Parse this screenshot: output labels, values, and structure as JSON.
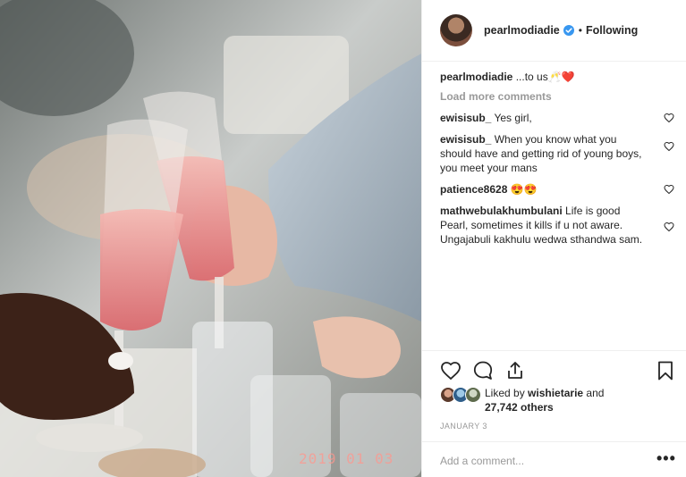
{
  "post": {
    "username": "pearlmodiadie",
    "following_label": "Following",
    "datestamp": "2019  01  03",
    "caption": {
      "username": "pearlmodiadie",
      "text": "...to us🥂❤️"
    },
    "load_more_label": "Load more comments",
    "comments": [
      {
        "username": "ewisisub_",
        "text": "Yes girl,"
      },
      {
        "username": "ewisisub_",
        "text": "When you know what you should have and getting rid of young boys, you meet your mans"
      },
      {
        "username": "patience8628",
        "text": "😍😍"
      },
      {
        "username": "mathwebulakhumbulani",
        "text": "Life is good Pearl, sometimes it kills if u not aware. Ungajabuli kakhulu wedwa sthandwa sam."
      }
    ],
    "likes": {
      "prefix": "Liked by",
      "liked_by_user": "wishietarie",
      "and_label": "and",
      "others": "27,742 others"
    },
    "date": "JANUARY 3",
    "add_comment_placeholder": "Add a comment...",
    "more_label": "•••"
  },
  "icons": {
    "verified": "verified-badge-icon",
    "like": "heart-icon",
    "comment": "comment-bubble-icon",
    "share": "share-icon",
    "save": "bookmark-icon",
    "comment_like": "heart-outline-icon"
  },
  "colors": {
    "verified_blue": "#3897f0",
    "muted_text": "#999999",
    "text": "#262626",
    "divider": "#efefef"
  }
}
